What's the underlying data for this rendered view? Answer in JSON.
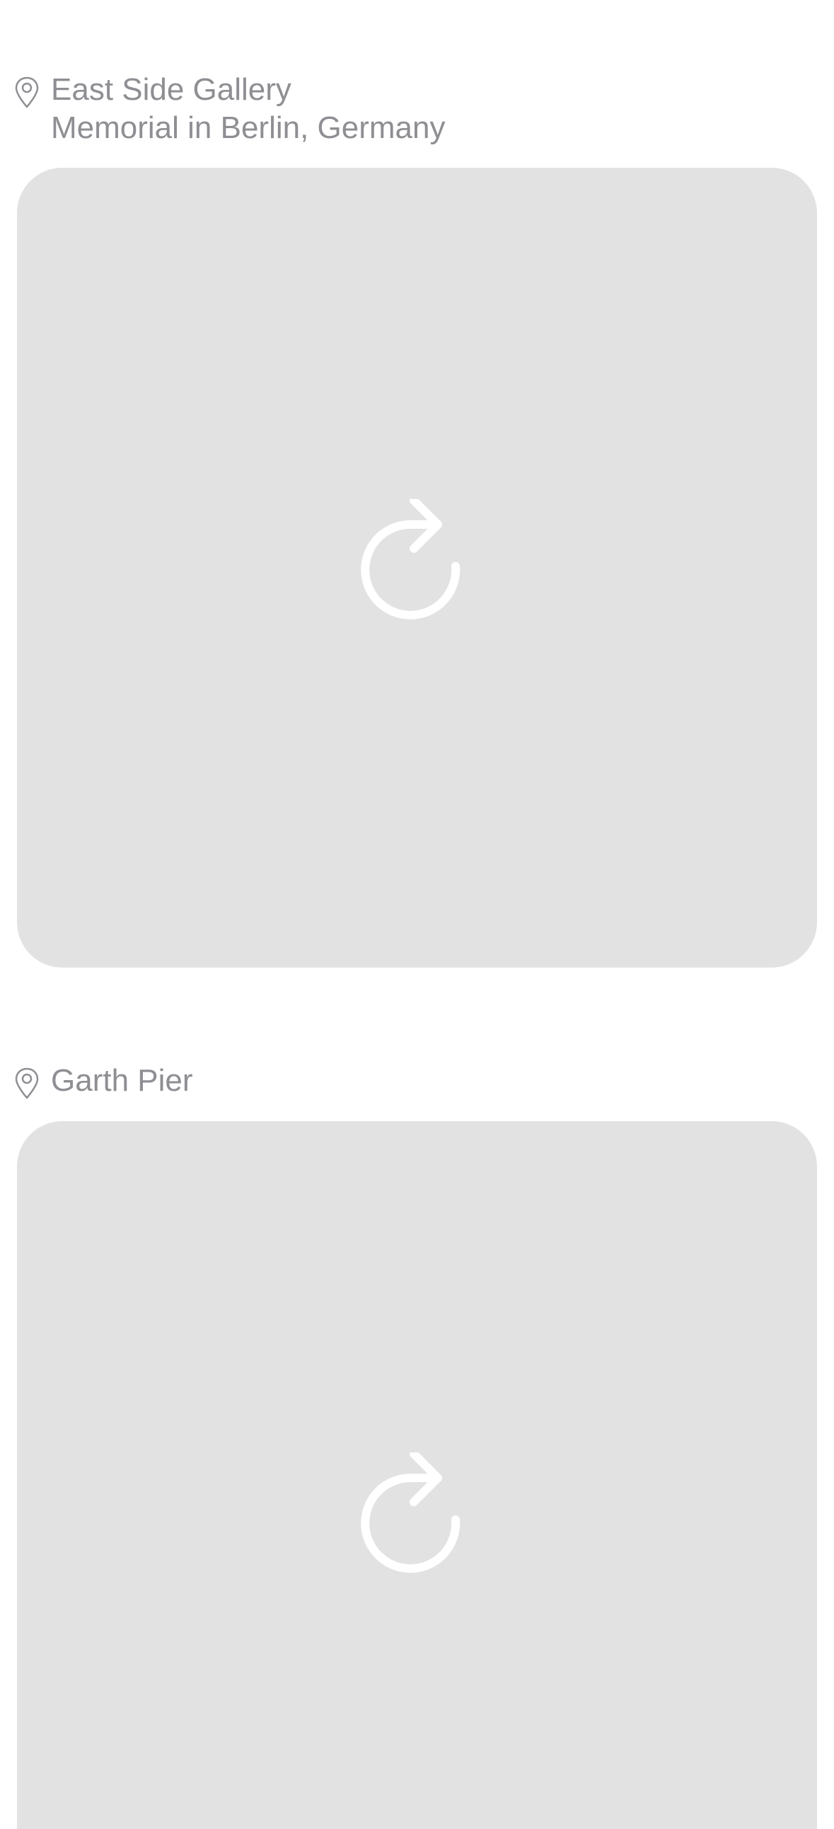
{
  "posts": [
    {
      "location_title": "East Side Gallery",
      "location_subtitle": "Memorial in Berlin, Germany",
      "pin_icon": "location-pin-icon",
      "media_state_icon": "reload-icon"
    },
    {
      "location_title": "Garth Pier",
      "location_subtitle": "",
      "pin_icon": "location-pin-icon",
      "media_state_icon": "reload-icon"
    }
  ],
  "colors": {
    "background": "#ffffff",
    "label_text": "#8e8e93",
    "placeholder_fill": "#e2e2e2",
    "icon_stroke": "#ffffff"
  }
}
